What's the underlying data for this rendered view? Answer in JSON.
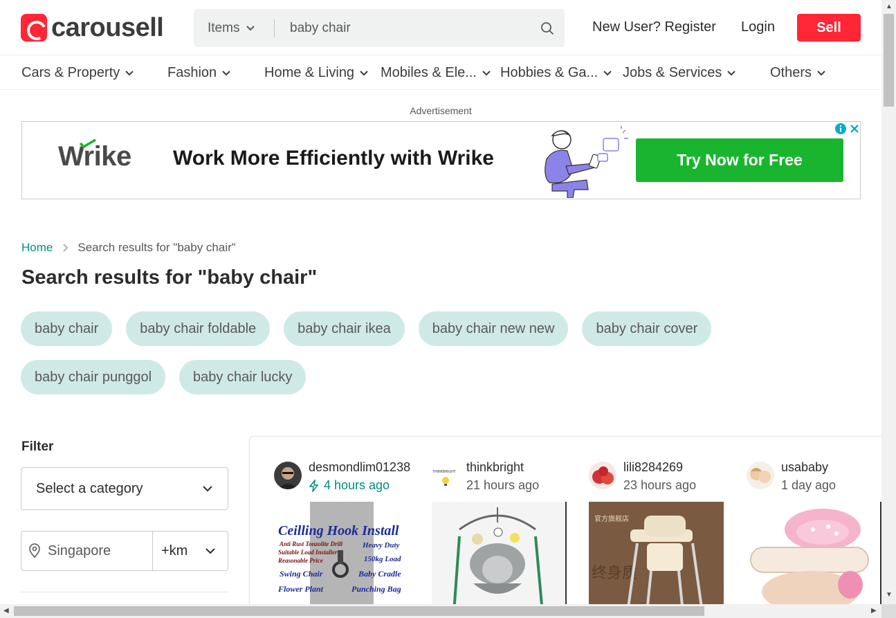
{
  "header": {
    "logo_text": "carousell",
    "search_category": "Items",
    "search_value": "baby chair",
    "register_label": "New User? Register",
    "login_label": "Login",
    "sell_label": "Sell",
    "brand_color": "#ff2636"
  },
  "nav": {
    "items": [
      {
        "label": "Cars & Property"
      },
      {
        "label": "Fashion"
      },
      {
        "label": "Home & Living"
      },
      {
        "label": "Mobiles & Ele..."
      },
      {
        "label": "Hobbies & Ga..."
      },
      {
        "label": "Jobs & Services"
      },
      {
        "label": "Others"
      }
    ]
  },
  "ad": {
    "label": "Advertisement",
    "brand": "Wrike",
    "headline": "Work More Efficiently with Wrike",
    "cta": "Try Now for Free",
    "cta_color": "#19b52e"
  },
  "breadcrumb": {
    "home": "Home",
    "current": "Search results for \"baby chair\""
  },
  "page_title": "Search results for \"baby chair\"",
  "chips": [
    "baby chair",
    "baby chair foldable",
    "baby chair ikea",
    "baby chair new new",
    "baby chair cover",
    "baby chair punggol",
    "baby chair lucky"
  ],
  "filter": {
    "title": "Filter",
    "category_placeholder": "Select a category",
    "location": "Singapore",
    "distance": "+km"
  },
  "listings": [
    {
      "seller": "desmondlim01238",
      "time": "4 hours ago",
      "bumped": true,
      "image_title": "Ceilling Hook Install",
      "image_lines": [
        "Anti Rust Tonzolite Drill",
        "Heavy Duty",
        "Suitable Load Installer",
        "150kg Load",
        "Reasonable Price",
        "Swing Chair",
        "Baby Cradle",
        "Flower Plant",
        "Punching Bag"
      ]
    },
    {
      "seller": "thinkbright",
      "time": "21 hours ago",
      "bumped": false,
      "avatar_text": "THINKBRIGHT"
    },
    {
      "seller": "lili8284269",
      "time": "23 hours ago",
      "bumped": false,
      "image_text": "官方旗舰店"
    },
    {
      "seller": "usababy",
      "time": "1 day ago",
      "bumped": false
    }
  ]
}
